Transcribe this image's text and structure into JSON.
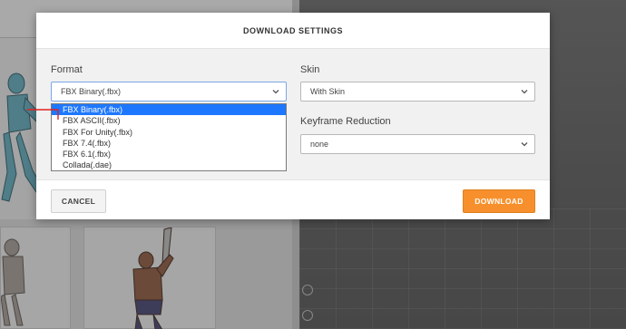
{
  "modal": {
    "title": "DOWNLOAD SETTINGS",
    "format": {
      "label": "Format",
      "selected": "FBX Binary(.fbx)",
      "options": [
        "FBX Binary(.fbx)",
        "FBX ASCII(.fbx)",
        "FBX For Unity(.fbx)",
        "FBX 7.4(.fbx)",
        "FBX 6.1(.fbx)",
        "Collada(.dae)"
      ]
    },
    "skin": {
      "label": "Skin",
      "selected": "With Skin"
    },
    "keyframe_reduction": {
      "label": "Keyframe Reduction",
      "selected": "none"
    },
    "cancel_label": "CANCEL",
    "download_label": "DOWNLOAD"
  },
  "colors": {
    "accent": "#f7902c",
    "selection": "#1e78ff",
    "marker": "#e02020"
  },
  "icons": [
    "chevron-down-icon",
    "reset-view-icon",
    "rotate-icon"
  ]
}
